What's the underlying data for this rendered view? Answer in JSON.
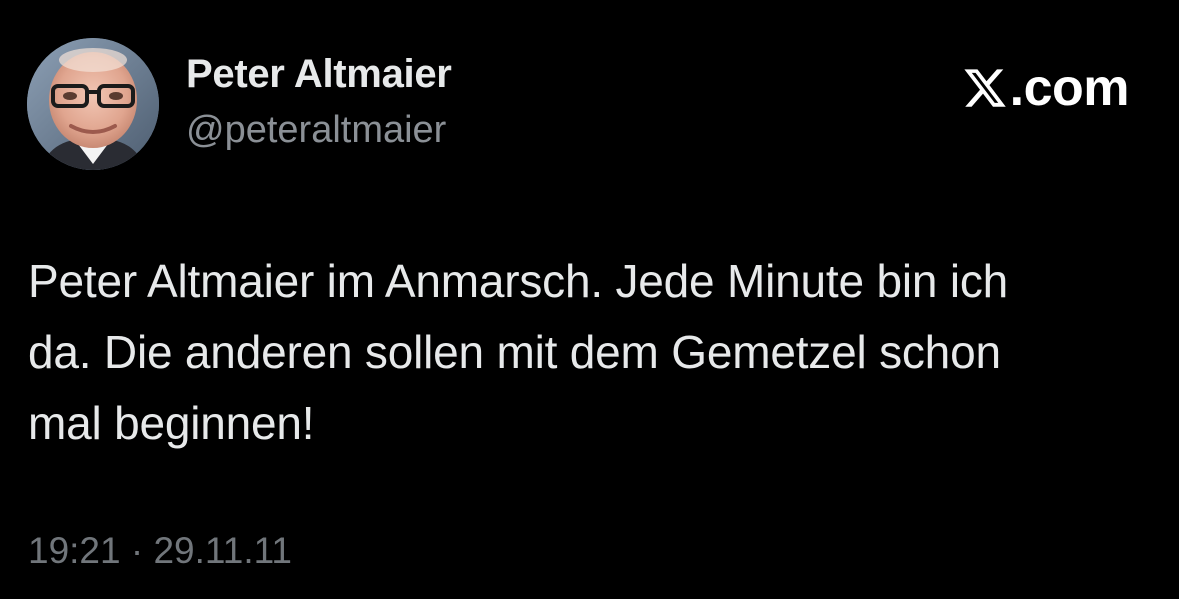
{
  "author": {
    "name": "Peter Altmaier",
    "handle": "@peteraltmaier",
    "avatar_icon": "profile-photo"
  },
  "brand": {
    "text": ".com",
    "icon": "x-logo-icon",
    "color": "#ffffff"
  },
  "tweet": {
    "lines": [
      "Peter Altmaier im Anmarsch. Jede Minute bin ich",
      "da. Die anderen sollen mit dem Gemetzel schon",
      "mal beginnen!"
    ],
    "timestamp": "19:21 · 29.11.11"
  },
  "colors": {
    "background": "#000000",
    "text_primary": "#e7e9ea",
    "text_secondary": "#71767b"
  }
}
